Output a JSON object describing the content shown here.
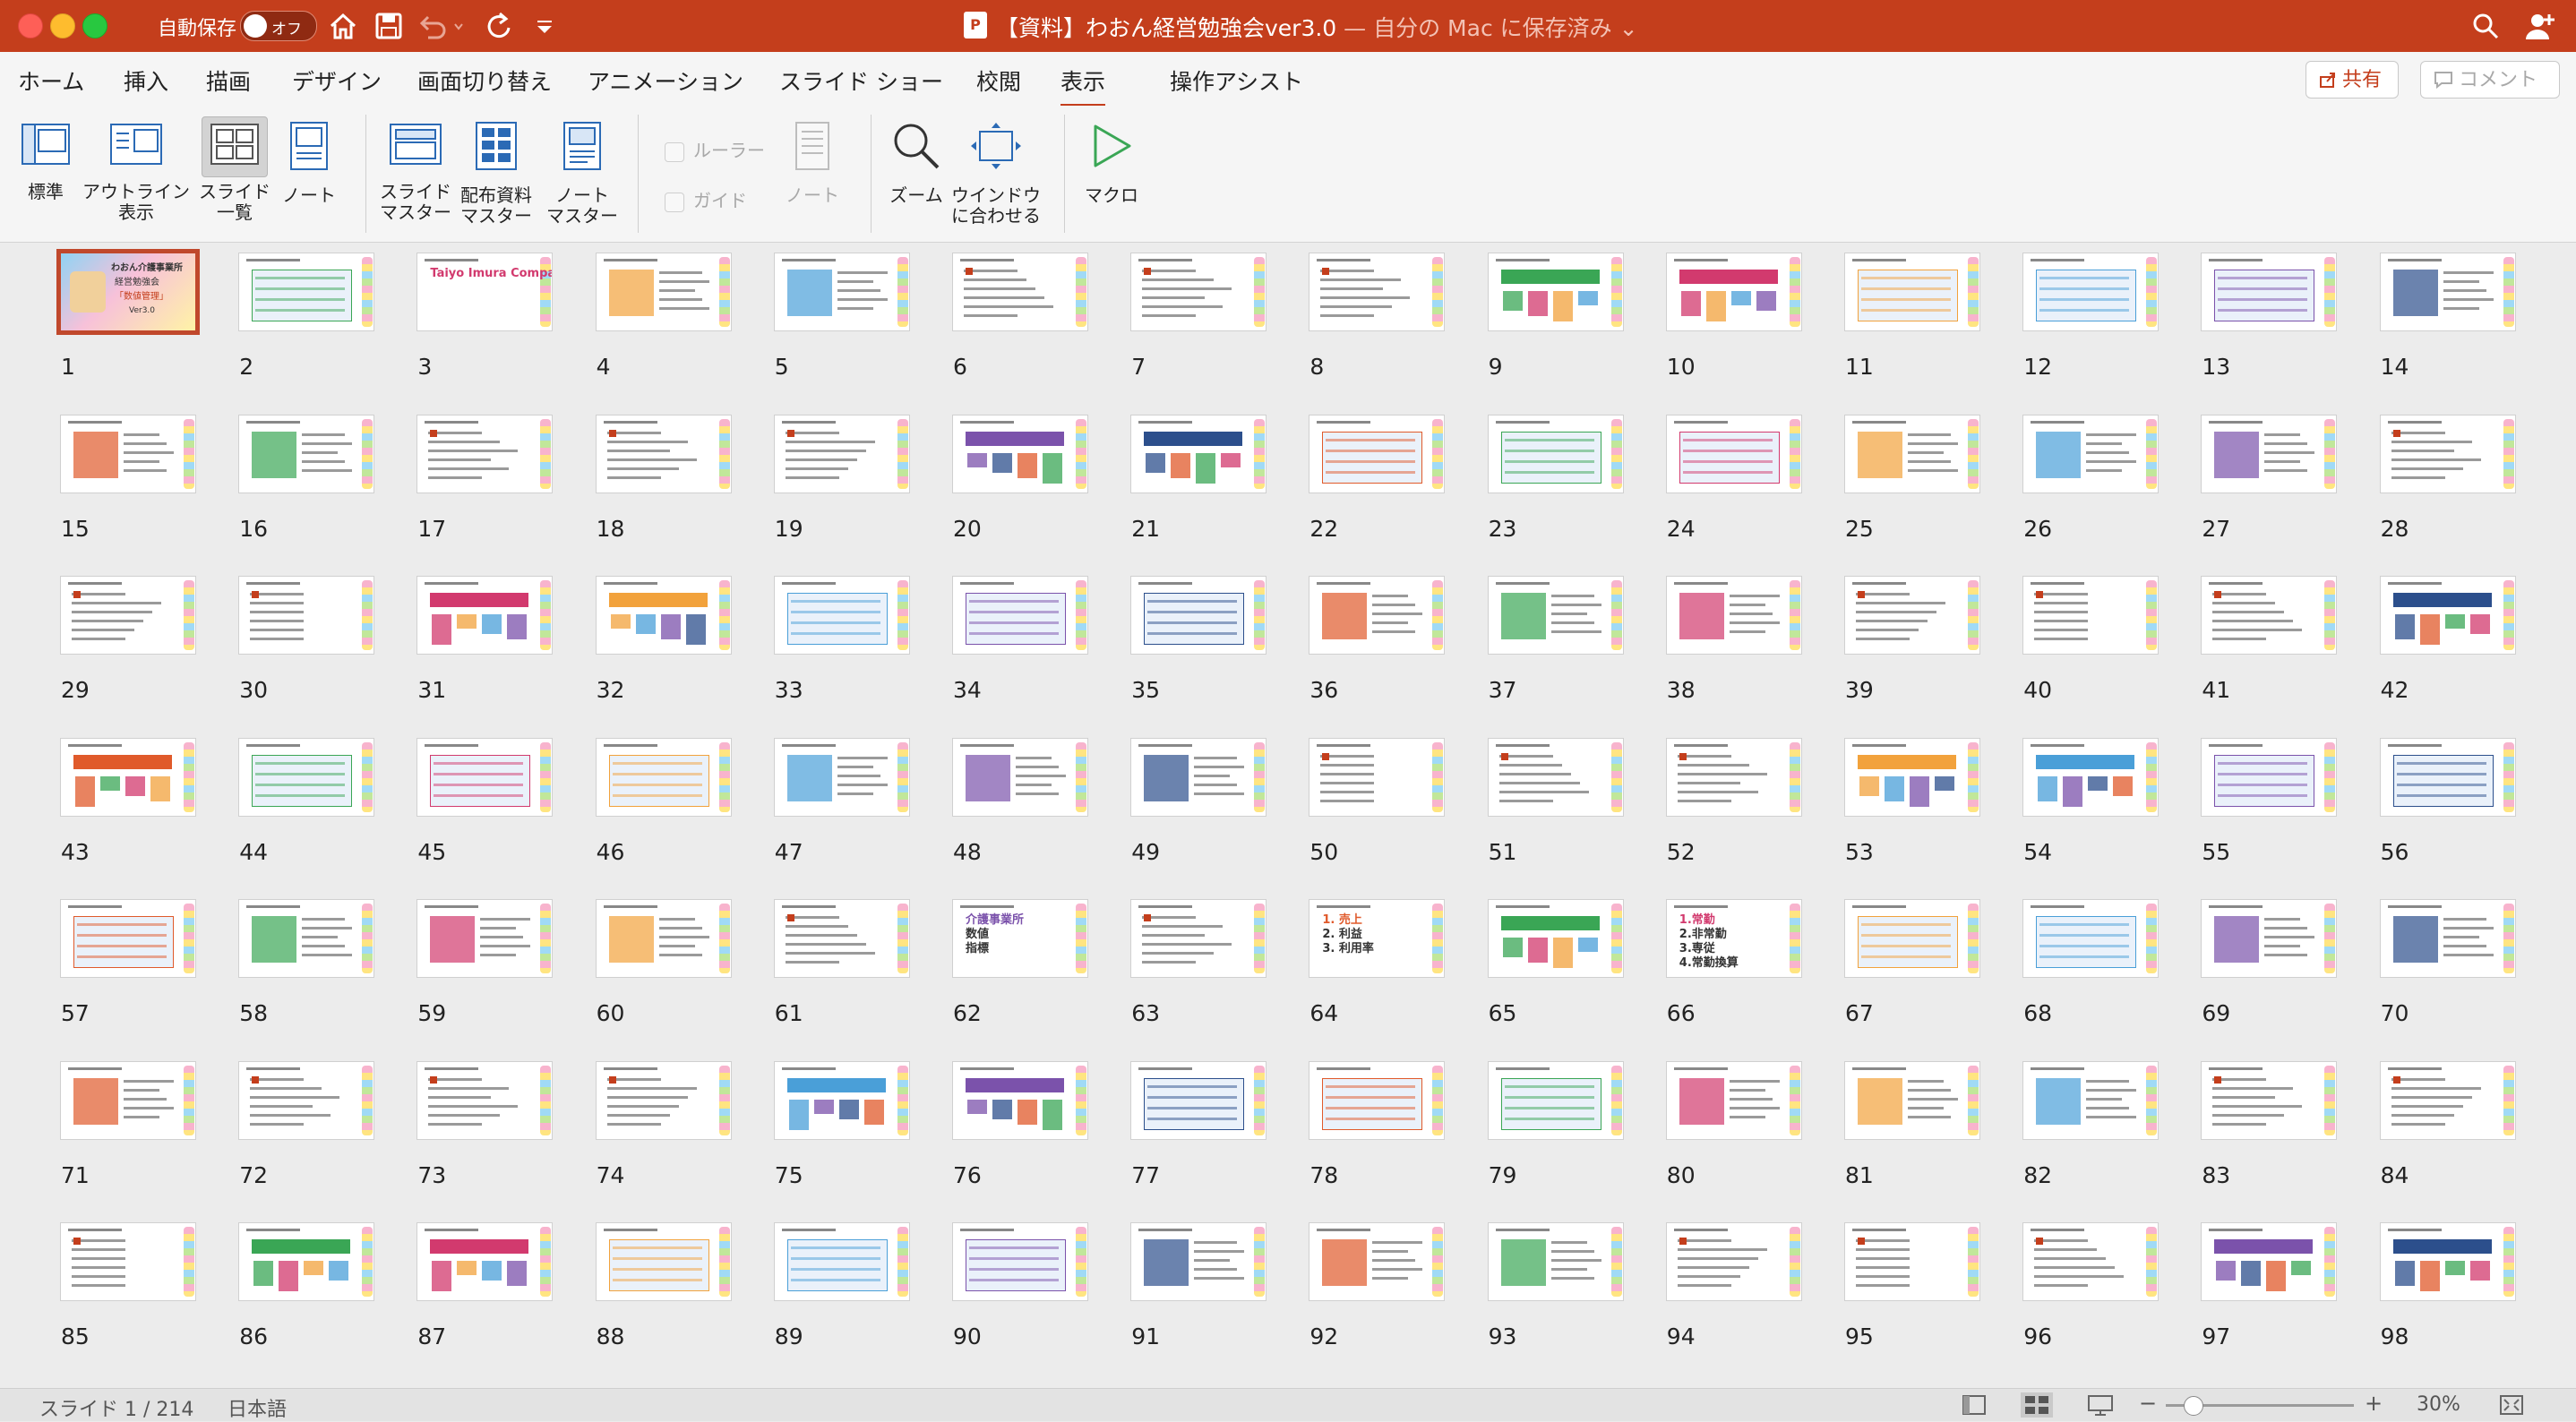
{
  "titlebar": {
    "autosave_label": "自動保存",
    "autosave_state": "オフ",
    "title": "【資料】わおん経営勉強会ver3.0",
    "title_suffix": " — 自分の Mac に保存済み ⌄"
  },
  "tabs": [
    "ホーム",
    "挿入",
    "描画",
    "デザイン",
    "画面切り替え",
    "アニメーション",
    "スライド ショー",
    "校閲",
    "表示",
    "操作アシスト"
  ],
  "active_tab": "表示",
  "share_label": "共有",
  "comment_label": "コメント",
  "ribbon": {
    "normal": "標準",
    "outline": [
      "アウトライン",
      "表示"
    ],
    "sorter": [
      "スライド",
      "一覧"
    ],
    "notes": "ノート",
    "slide_master": [
      "スライド",
      "マスター"
    ],
    "handout_master": [
      "配布資料",
      "マスター"
    ],
    "notes_master": [
      "ノート",
      "マスター"
    ],
    "ruler": "ルーラー",
    "guides": "ガイド",
    "notes_disabled": "ノート",
    "zoom": "ズーム",
    "fit_window": [
      "ウインドウ",
      "に合わせる"
    ],
    "macro": "マクロ"
  },
  "slides": {
    "count": 98,
    "selected": 1,
    "texts": {
      "1": [
        "わおん介護事業所",
        "経営勉強会",
        "「数値管理」",
        "Ver3.0"
      ],
      "3": [
        "Taiyo Imura Company"
      ],
      "62": [
        "介護事業所",
        "数値",
        "指標"
      ],
      "64": [
        "1. 売上",
        "2. 利益",
        "3. 利用率"
      ],
      "66": [
        "1.常勤",
        "2.非常勤",
        "3.専従",
        "4.常勤換算"
      ]
    }
  },
  "status": {
    "slide_info": "スライド 1 / 214",
    "language": "日本語",
    "zoom": "30%"
  }
}
